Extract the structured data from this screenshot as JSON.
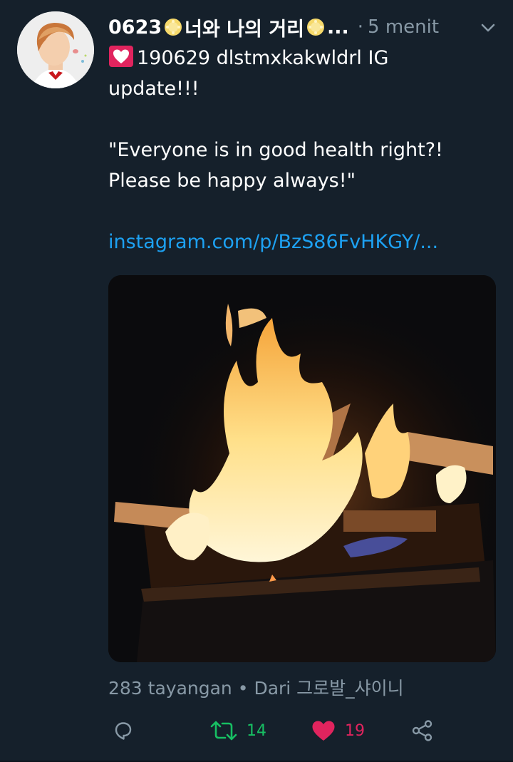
{
  "tweet": {
    "display_name_part1": "0623",
    "display_name_part2": "너와 나의 거리",
    "display_name_ellipsis": "...",
    "separator": "·",
    "time": "5 menit",
    "line1": "190629 dlstmxkakwldrl IG",
    "line2": "update!!!",
    "quote_line1": "\"Everyone is in good health right?!",
    "quote_line2": "Please be happy always!\"",
    "link": "instagram.com/p/BzS86FvHKGY/..."
  },
  "media": {
    "views": "283 tayangan",
    "bullet": "•",
    "source": "Dari 그로발_샤이니"
  },
  "actions": {
    "retweet_count": "14",
    "like_count": "19"
  },
  "colors": {
    "background": "#15202b",
    "secondary_text": "#8899a6",
    "link": "#1da1f2",
    "retweet_green": "#17bf63",
    "like_pink": "#e0245e"
  },
  "icons": {
    "avatar": "profile-photo",
    "emoji_sun": "sun-emoji-icon",
    "emoji_heart": "heart-emoji-icon",
    "chevron": "chevron-down-icon",
    "reply": "reply-icon",
    "retweet": "retweet-icon",
    "like": "heart-icon",
    "share": "share-icon"
  }
}
